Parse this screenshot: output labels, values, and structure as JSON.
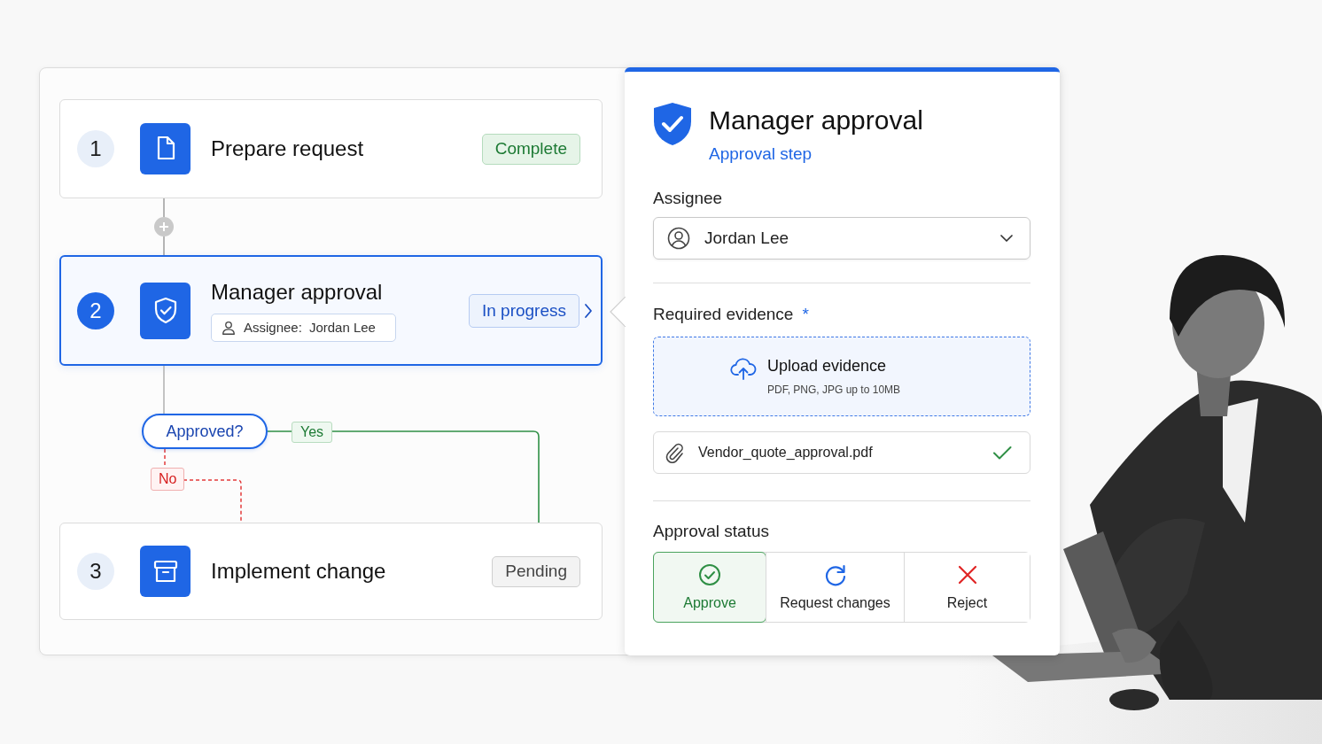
{
  "steps": [
    {
      "number": "1",
      "title": "Prepare request",
      "status": "Complete",
      "kind": "complete",
      "selected": false
    },
    {
      "number": "2",
      "title": "Manager approval",
      "status": "In progress",
      "kind": "in_progress",
      "selected": true,
      "assignee_label": "Assignee:",
      "assignee": "Jordan Lee"
    },
    {
      "number": "3",
      "title": "Implement change",
      "status": "Pending",
      "kind": "pending",
      "selected": false
    }
  ],
  "decision": {
    "label": "Approved?",
    "yes": "Yes",
    "no": "No"
  },
  "panel": {
    "title": "Manager approval",
    "subtitle": "Approval step",
    "assignee": {
      "label": "Assignee",
      "value": "Jordan Lee"
    },
    "evidence": {
      "label": "Required evidence",
      "required_mark": "*",
      "upload_title": "Upload evidence",
      "upload_hint": "PDF, PNG, JPG up to 10MB",
      "files": [
        {
          "name": "Vendor_quote_approval.pdf",
          "verified": true
        }
      ]
    },
    "approval": {
      "label": "Approval status",
      "options": [
        {
          "label": "Approve",
          "kind": "approve",
          "selected": true
        },
        {
          "label": "Request changes",
          "kind": "request_changes",
          "selected": false
        },
        {
          "label": "Reject",
          "kind": "reject",
          "selected": false
        }
      ]
    }
  }
}
